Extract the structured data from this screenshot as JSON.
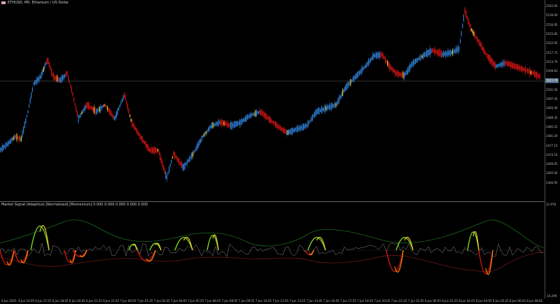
{
  "header": {
    "symbol": "ETHUSD, M5: Ethereum / US Dollar",
    "indicator": "Market Signal (Adaptive) [Normalized] [Momentum] 0.000 0.000 0.000 0.000 0.000"
  },
  "price_axis": [
    "2542.65",
    "2536.00",
    "2530.95",
    "2525.85",
    "2522.05",
    "2517.75",
    "2513.70",
    "2509.65",
    "2505.60",
    "2501.50",
    "2497.45",
    "2493.40",
    "2489.35",
    "2485.25",
    "2481.20",
    "2477.15",
    "2473.10",
    "2469.05",
    "2465.00",
    "2460.95"
  ],
  "current_price": "2511.70",
  "indicator_axis": [
    "15.978",
    "-16.299"
  ],
  "time_axis": [
    "6 Jun 2025",
    "6 Jun 16:05",
    "6 Jun 17:25",
    "6 Jun 18:45",
    "6 Jun 20:05",
    "6 Jun 21:25",
    "6 Jun 22:45",
    "7 Jun 00:05",
    "7 Jun 01:25",
    "7 Jun 02:45",
    "7 Jun 04:05",
    "7 Jun 05:25",
    "7 Jun 06:45",
    "7 Jun 08:05",
    "7 Jun 09:25",
    "7 Jun 10:45",
    "7 Jun 12:05",
    "7 Jun 13:25",
    "7 Jun 14:45",
    "7 Jun 16:05",
    "7 Jun 17:25",
    "7 Jun 18:45",
    "7 Jun 20:05",
    "7 Jun 21:25",
    "7 Jun 22:45",
    "8 Jun 00:05",
    "8 Jun 01:25",
    "8 Jun 02:45",
    "8 Jun 04:05",
    "8 Jun 05:25",
    "8 Jun 06:45",
    "8 Jun 08:05"
  ],
  "colors": {
    "up": "#2f7fd6",
    "down": "#d31414",
    "neutral": "#e8c82a",
    "osc_pos": "#7bd629",
    "osc_neg": "#ff8a00",
    "band_pos": "#1e6a1e",
    "band_neg": "#6a1b1b",
    "osc_gray": "#8a8a8a"
  }
}
